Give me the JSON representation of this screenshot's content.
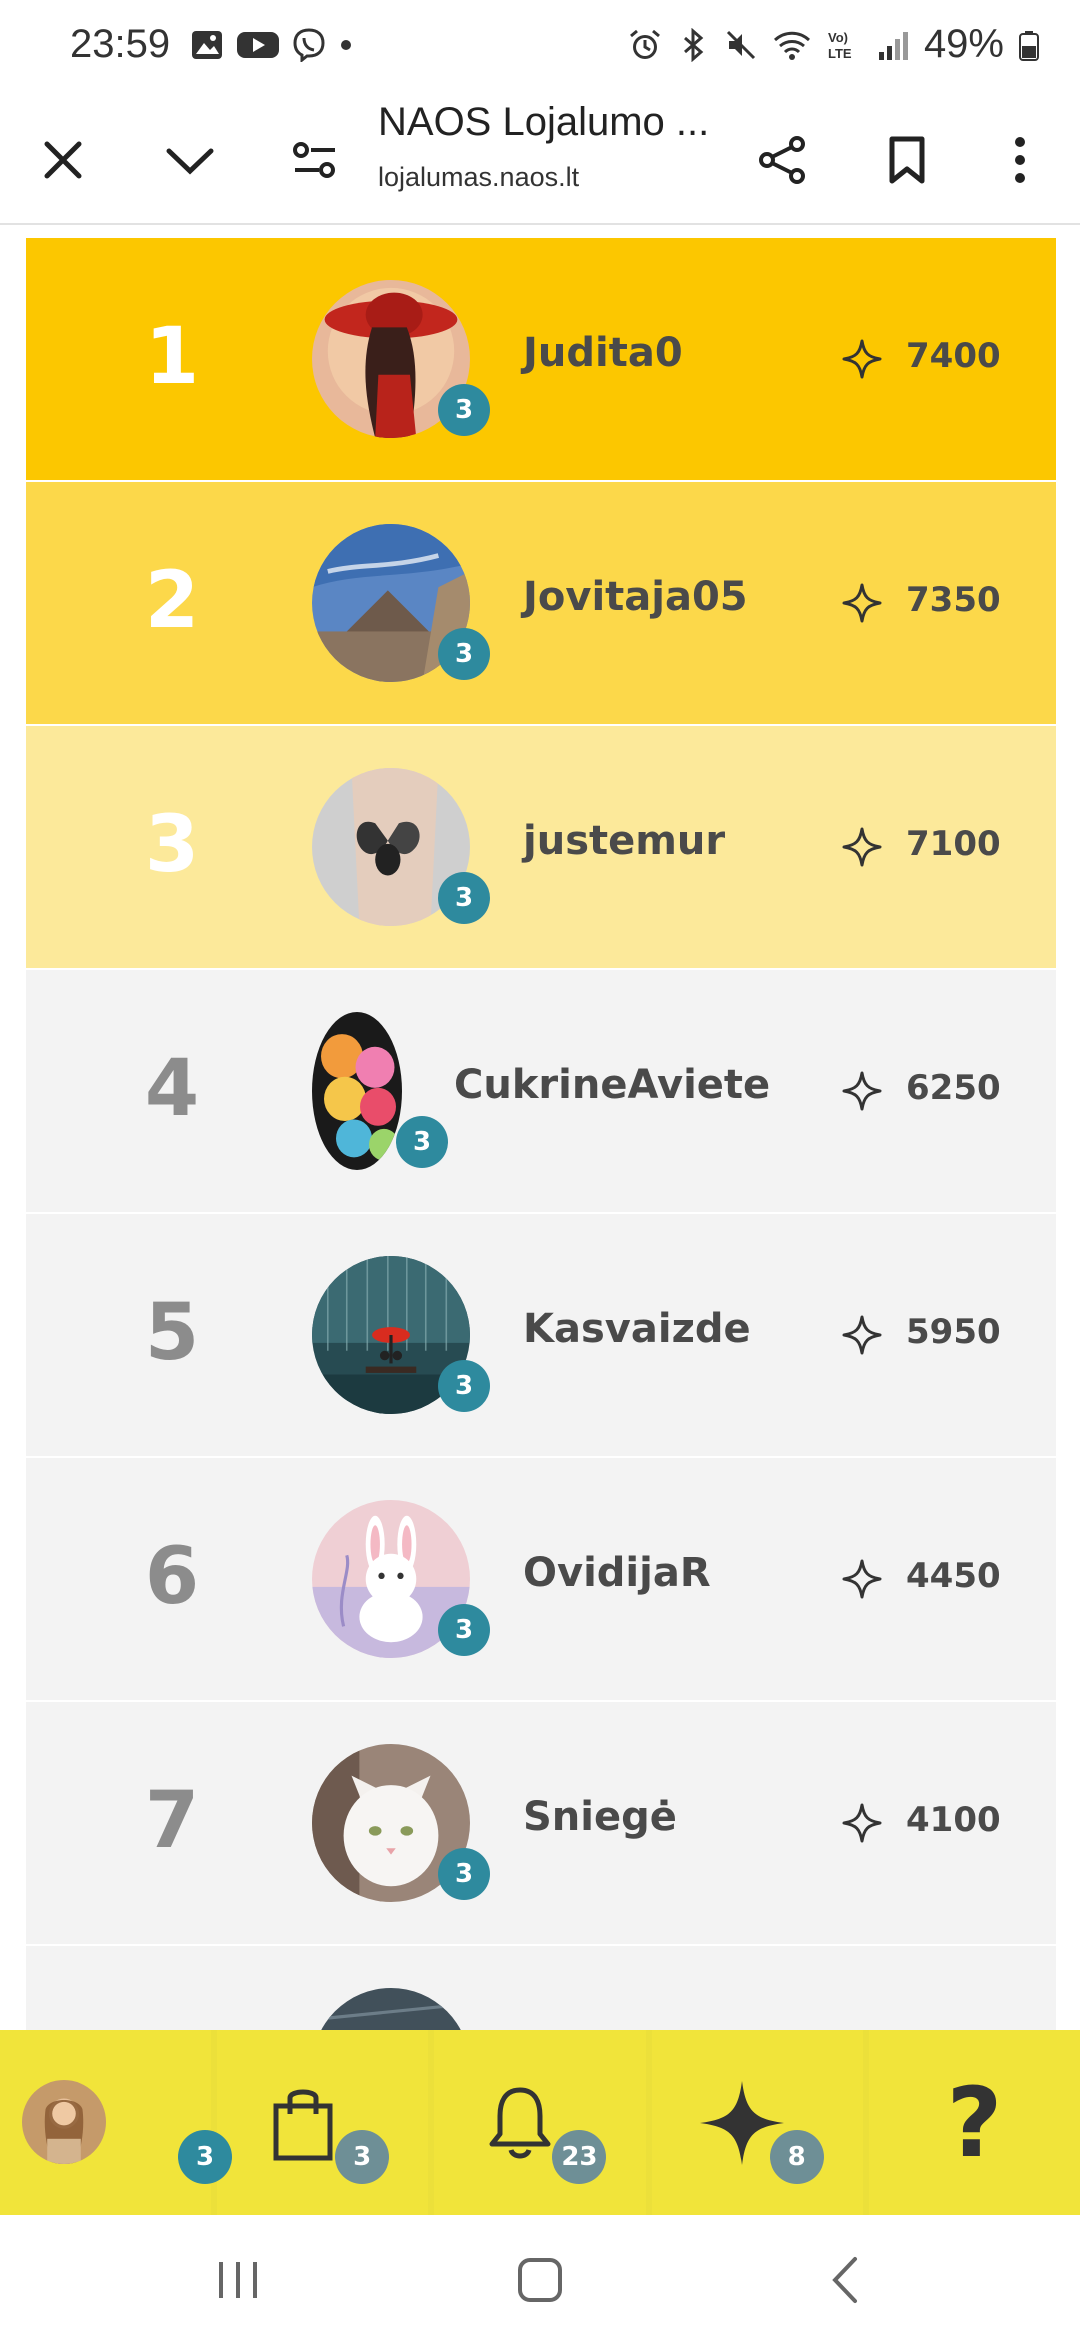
{
  "status_bar": {
    "time": "23:59",
    "battery": "49%",
    "left_icons": [
      "gallery-icon",
      "youtube-icon",
      "viber-icon",
      "dot-icon"
    ],
    "right_icons": [
      "alarm-icon",
      "bluetooth-icon",
      "mute-icon",
      "wifi-icon",
      "volte-icon",
      "signal-icon",
      "battery-icon"
    ]
  },
  "browser": {
    "title": "NAOS Lojalumo ...",
    "url": "lojalumas.naos.lt"
  },
  "leaderboard": [
    {
      "rank": "1",
      "name": "Judita0",
      "points": "7400",
      "level": "3",
      "tier": "gold"
    },
    {
      "rank": "2",
      "name": "Jovitaja05",
      "points": "7350",
      "level": "3",
      "tier": "silver"
    },
    {
      "rank": "3",
      "name": "justemur",
      "points": "7100",
      "level": "3",
      "tier": "bronze"
    },
    {
      "rank": "4",
      "name": "CukrineAviete",
      "points": "6250",
      "level": "3",
      "tier": "plain"
    },
    {
      "rank": "5",
      "name": "Kasvaizde",
      "points": "5950",
      "level": "3",
      "tier": "plain"
    },
    {
      "rank": "6",
      "name": "OvidijaR",
      "points": "4450",
      "level": "3",
      "tier": "plain"
    },
    {
      "rank": "7",
      "name": "Sniegė",
      "points": "4100",
      "level": "3",
      "tier": "plain"
    }
  ],
  "bottom_nav": {
    "profile_badge": "3",
    "shop_badge": "3",
    "notifications_badge": "23",
    "points_badge": "8",
    "help_label": "?"
  },
  "colors": {
    "gold": "#fcc700",
    "silver": "#fcd84a",
    "bronze": "#fce99a",
    "plain": "#f3f3f3",
    "level_badge": "#2e8a9e",
    "nav_bar": "#f1e43a"
  }
}
